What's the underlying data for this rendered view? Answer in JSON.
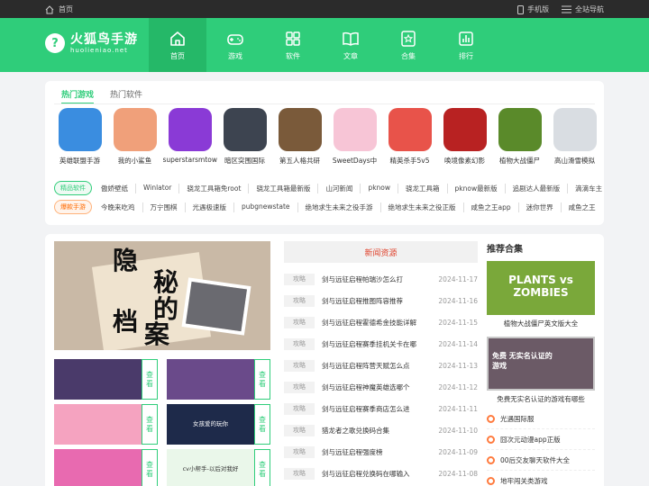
{
  "topbar": {
    "home": "首页",
    "mobile": "手机版",
    "sitemap": "全站导航"
  },
  "logo": {
    "name": "火狐鸟手游",
    "domain": "huolieniao.net"
  },
  "nav": [
    {
      "label": "首页",
      "icon": "home-icon"
    },
    {
      "label": "游戏",
      "icon": "gamepad-icon"
    },
    {
      "label": "软件",
      "icon": "grid-icon"
    },
    {
      "label": "文章",
      "icon": "book-icon"
    },
    {
      "label": "合集",
      "icon": "star-badge-icon"
    },
    {
      "label": "排行",
      "icon": "bar-chart-icon"
    }
  ],
  "hot": {
    "tabs": [
      "热门游戏",
      "热门软件"
    ],
    "apps": [
      {
        "name": "英雄联盟手游",
        "color": "#3a8de0"
      },
      {
        "name": "我的小鲨鱼",
        "color": "#f0a07a"
      },
      {
        "name": "superstarsmtow",
        "color": "#8a3ad6"
      },
      {
        "name": "暗区突围国际",
        "color": "#3d4450"
      },
      {
        "name": "第五人格共研",
        "color": "#7a5a3a"
      },
      {
        "name": "SweetDays中",
        "color": "#f7c5d6"
      },
      {
        "name": "精英杀手5v5",
        "color": "#e8534a"
      },
      {
        "name": "唤境像素幻影",
        "color": "#b82222"
      },
      {
        "name": "植物大战僵尸",
        "color": "#5a8a2a"
      },
      {
        "name": "高山滑雪模拟",
        "color": "#d9dde2"
      }
    ],
    "software_label": "精品软件",
    "software_links": [
      "傲娇壁纸",
      "Winlator",
      "骁龙工具箱免root",
      "骁龙工具箱最新版",
      "山河新闻",
      "pknow",
      "骁龙工具箱",
      "pknow最新版",
      "追剧达人最新版",
      "滴滴车主"
    ],
    "games_label": "爆款手游",
    "games_links": [
      "今晚来吃鸡",
      "万宁围棋",
      "光遇极速版",
      "pubgnewstate",
      "绝地求生未来之役手游",
      "绝地求生未来之役正版",
      "咸鱼之王app",
      "迷你世界",
      "咸鱼之王"
    ]
  },
  "banner": {
    "chars": [
      "隐",
      "秘",
      "的",
      "档",
      "案"
    ]
  },
  "thumbs": {
    "see_label": "查看",
    "items": [
      {
        "color": "#4a3a6a"
      },
      {
        "color": "#6a4a8a"
      },
      {
        "color": "#f5a3c0"
      },
      {
        "color": "#1e2a4a",
        "text": "女孩爱的玩你"
      },
      {
        "color": "#e86ab0"
      },
      {
        "color": "#eaf7ea",
        "text": "cv小帮手-以后对我好"
      }
    ]
  },
  "news": {
    "title": "新闻资源",
    "category": "攻略",
    "items": [
      {
        "title": "剑与远征启程帕瑞沙怎么打",
        "date": "2024-11-17"
      },
      {
        "title": "剑与远征启程推图阵容推荐",
        "date": "2024-11-16"
      },
      {
        "title": "剑与远征启程霍德希金技能详解",
        "date": "2024-11-15"
      },
      {
        "title": "剑与远征启程赛季挂机关卡在哪",
        "date": "2024-11-14"
      },
      {
        "title": "剑与远征启程阵营天赋怎么点",
        "date": "2024-11-13"
      },
      {
        "title": "剑与远征启程神魔英雄选哪个",
        "date": "2024-11-12"
      },
      {
        "title": "剑与远征启程赛季商店怎么进",
        "date": "2024-11-11"
      },
      {
        "title": "猎龙者之歌兑换码合集",
        "date": "2024-11-10"
      },
      {
        "title": "剑与远征启程强度榜",
        "date": "2024-11-09"
      },
      {
        "title": "剑与远征启程兑换码在哪输入",
        "date": "2024-11-08"
      }
    ]
  },
  "recommend": {
    "title": "推荐合集",
    "cards": [
      {
        "caption": "植物大战僵尸英文版大全",
        "text": "PLANTS vs ZOMBIES"
      },
      {
        "caption": "免费无实名认证的游戏有哪些",
        "text": "免费 无实名认证的游戏"
      }
    ],
    "list": [
      "光遇国际服",
      "囧次元动漫app正版",
      "00后交友聊天软件大全",
      "地牢闯关类游戏"
    ]
  }
}
